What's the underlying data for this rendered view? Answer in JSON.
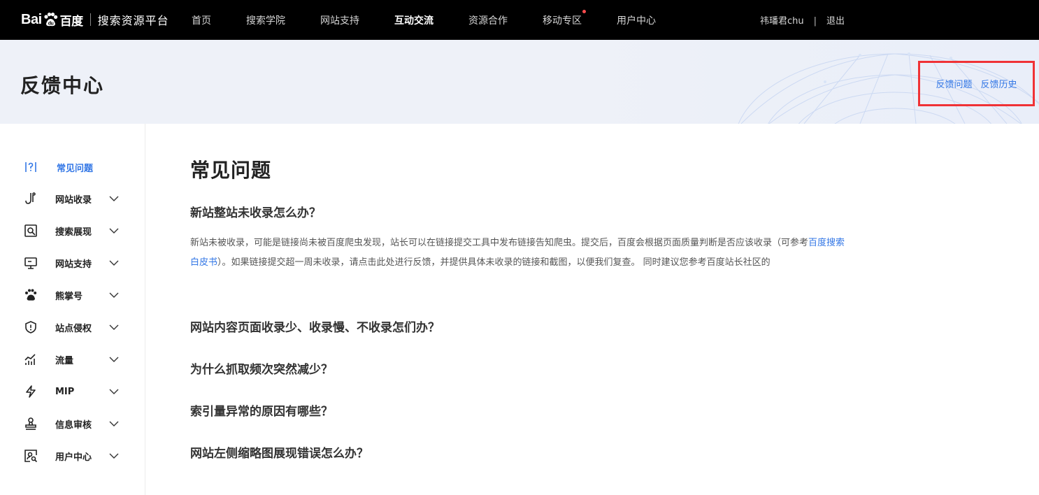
{
  "brand": {
    "logo_left": "Bai",
    "logo_right": "百度",
    "platform_name": "搜索资源平台"
  },
  "nav": {
    "items": [
      "首页",
      "搜索学院",
      "网站支持",
      "互动交流",
      "资源合作",
      "移动专区",
      "用户中心"
    ],
    "active": "互动交流",
    "dot_on": "移动专区"
  },
  "user": {
    "name": "祎璠君chu",
    "separator": "|",
    "logout": "退出"
  },
  "banner": {
    "title": "反馈中心",
    "links": [
      "反馈问题",
      "反馈历史"
    ],
    "highlight_color": "#f03236"
  },
  "sidebar": {
    "items": [
      {
        "label": "常见问题",
        "icon": "faq-icon",
        "active": true,
        "expandable": false
      },
      {
        "label": "网站收录",
        "icon": "index-hook-icon",
        "expandable": true
      },
      {
        "label": "搜索展现",
        "icon": "search-display-icon",
        "expandable": true
      },
      {
        "label": "网站支持",
        "icon": "monitor-icon",
        "expandable": true
      },
      {
        "label": "熊掌号",
        "icon": "paw-icon",
        "expandable": true
      },
      {
        "label": "站点侵权",
        "icon": "shield-icon",
        "expandable": true
      },
      {
        "label": "流量",
        "icon": "traffic-chart-icon",
        "expandable": true
      },
      {
        "label": "MIP",
        "icon": "lightning-icon",
        "expandable": true
      },
      {
        "label": "信息审核",
        "icon": "stamp-icon",
        "expandable": true
      },
      {
        "label": "用户中心",
        "icon": "user-card-icon",
        "expandable": true
      }
    ],
    "accent_color": "#3377e6"
  },
  "main": {
    "title": "常见问题",
    "questions": [
      "新站整站未收录怎么办？",
      "网站内容页面收录少、收录慢、不收录怎们办？",
      "为什么抓取频次突然减少？",
      "索引量异常的原因有哪些？",
      "网站左侧缩略图展现错误怎么办？"
    ],
    "answer": {
      "part1": "新站未被收录，可能是链接尚未被百度爬虫发现，站长可以在链接提交工具中发布链接告知爬虫。提交后，百度会根据页面质量判断是否应该收录（可参考",
      "link": "百度搜索白皮书",
      "part2": "）。如果链接提交超一周未收录，请点击此处进行反馈，并提供具体未收录的链接和截图，以便我们复查。 同时建议您参考百度站长社区的"
    }
  }
}
